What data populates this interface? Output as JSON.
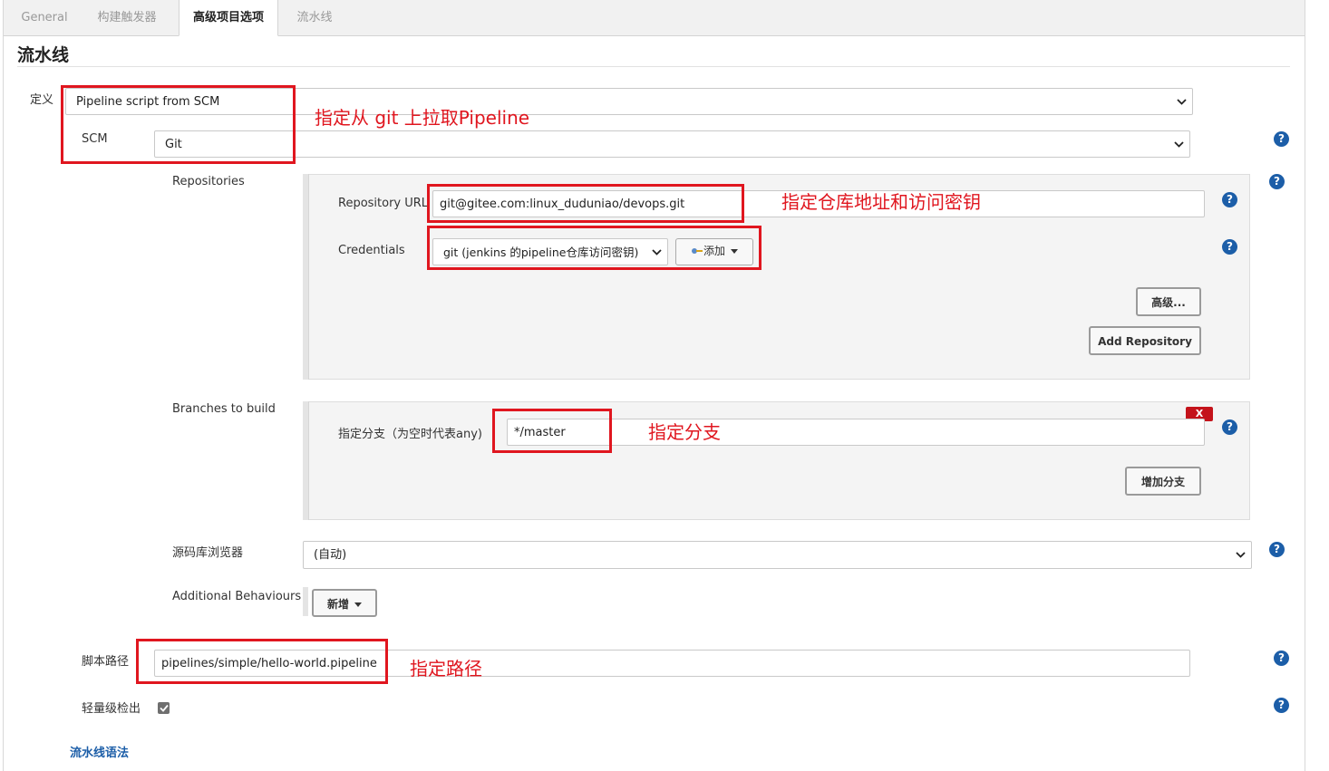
{
  "tabs": [
    "General",
    "构建触发器",
    "高级项目选项",
    "流水线"
  ],
  "section_title": "流水线",
  "definition": {
    "label": "定义",
    "value": "Pipeline script from SCM"
  },
  "scm": {
    "label": "SCM",
    "value": "Git"
  },
  "repositories": {
    "label": "Repositories",
    "repo_url_label": "Repository URL",
    "repo_url_value": "git@gitee.com:linux_duduniao/devops.git",
    "credentials_label": "Credentials",
    "credentials_value": "git (jenkins 的pipeline仓库访问密钥)",
    "add_button": "添加",
    "advanced_button": "高级...",
    "add_repository_button": "Add Repository"
  },
  "branches": {
    "label": "Branches to build",
    "branch_label": "指定分支（为空时代表any)",
    "branch_value": "*/master",
    "delete_button": "X",
    "add_branch_button": "增加分支"
  },
  "browser": {
    "label": "源码库浏览器",
    "value": "(自动)"
  },
  "behaviours": {
    "label": "Additional Behaviours",
    "add_button": "新增"
  },
  "script_path": {
    "label": "脚本路径",
    "value": "pipelines/simple/hello-world.pipeline"
  },
  "lightweight": {
    "label": "轻量级检出",
    "checked": true
  },
  "syntax_link": "流水线语法",
  "annotations": {
    "scm": "指定从 git 上拉取Pipeline",
    "repo": "指定仓库地址和访问密钥",
    "branch": "指定分支",
    "path": "指定路径"
  },
  "help_glyph": "?",
  "colors": {
    "annotation": "#e0161f",
    "help": "#1c5ea8",
    "link": "#1c5ea8"
  }
}
